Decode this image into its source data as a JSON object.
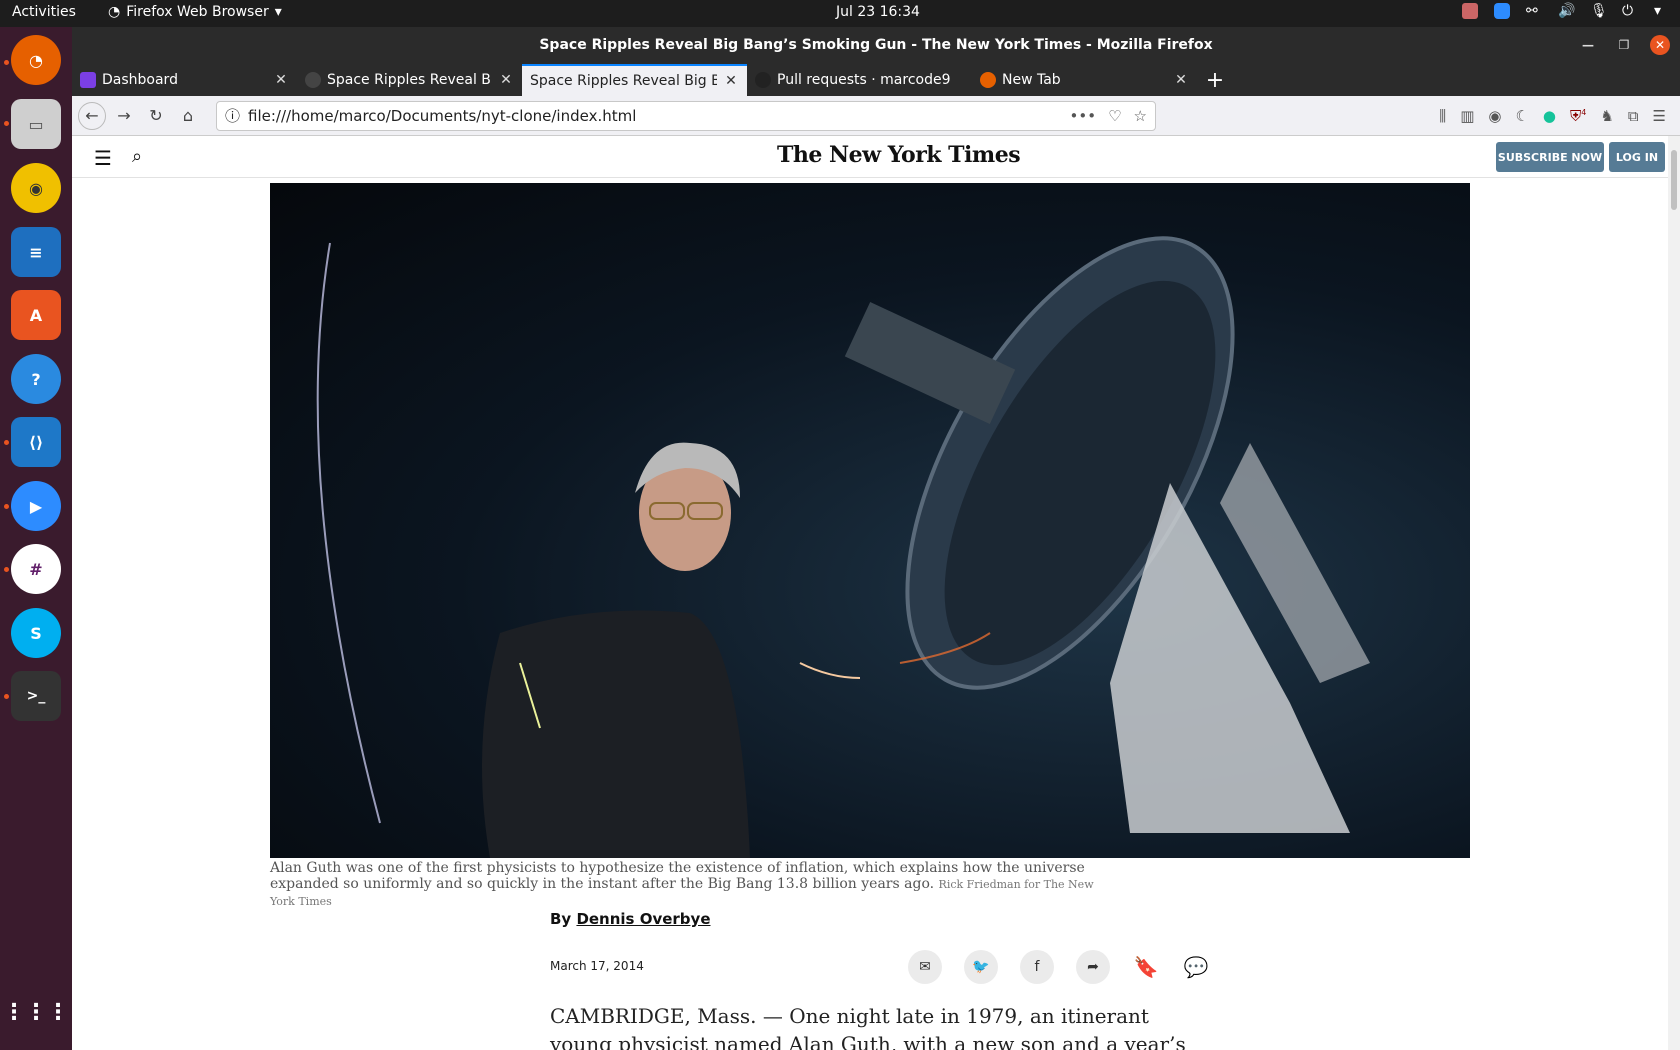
{
  "topbar": {
    "activities": "Activities",
    "app_name": "Firefox Web Browser",
    "clock": "Jul 23  16:34"
  },
  "dock": {
    "apps": [
      "firefox-icon",
      "files-icon",
      "rhythmbox-icon",
      "writer-icon",
      "software-icon",
      "help-icon",
      "vscode-icon",
      "zoom-icon",
      "slack-icon",
      "skype-icon",
      "terminal-icon"
    ]
  },
  "window": {
    "title": "Space Ripples Reveal Big Bang’s Smoking Gun - The New York Times - Mozilla Firefox"
  },
  "tabs": [
    {
      "label": "Dashboard"
    },
    {
      "label": "Space Ripples Reveal Big"
    },
    {
      "label": "Space Ripples Reveal Big Ba"
    },
    {
      "label": "Pull requests · marcode9"
    },
    {
      "label": "New Tab"
    }
  ],
  "navbar": {
    "url": "file:///home/marco/Documents/nyt-clone/index.html",
    "badge_count": "4"
  },
  "nyt": {
    "logo": "The New York Times",
    "subscribe_label": "SUBSCRIBE NOW",
    "login_label": "LOG IN"
  },
  "article": {
    "caption": "Alan Guth was one of the first physicists to hypothesize the existence of inflation, which explains how the universe expanded so uniformly and so quickly in the instant after the Big Bang 13.8 billion years ago.",
    "credit": "Rick Friedman for The New York Times",
    "byline_prefix": "By ",
    "author": "Dennis Overbye",
    "date": "March 17, 2014",
    "body": "CAMBRIDGE, Mass. — One night late in 1979, an itinerant young physicist named Alan Guth, with a new son and a year’s appointment at"
  }
}
